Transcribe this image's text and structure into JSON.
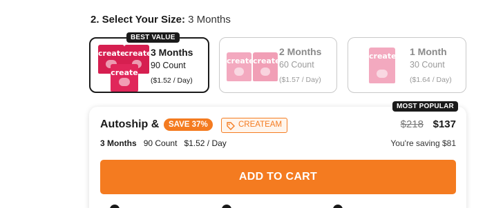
{
  "size_section": {
    "label": "2. Select Your Size:",
    "selected": "3 Months"
  },
  "options": [
    {
      "badge": "BEST VALUE",
      "name": "3 Months",
      "count": "90 Count",
      "per_day": "($1.52 / Day)",
      "pouch_brand": "create",
      "selected": true
    },
    {
      "name": "2 Months",
      "count": "60 Count",
      "per_day": "($1.57 / Day)",
      "pouch_brand": "create",
      "selected": false
    },
    {
      "name": "1 Month",
      "count": "30 Count",
      "per_day": "($1.64 / Day)",
      "pouch_brand": "create",
      "selected": false
    }
  ],
  "autoship": {
    "badge": "MOST POPULAR",
    "title": "Autoship &",
    "save_label": "SAVE 37%",
    "promo_code": "CREATEAM",
    "old_price": "$218",
    "new_price": "$137",
    "plan": "3 Months",
    "count": "90 Count",
    "per_day": "$1.52 / Day",
    "saving_text": "You're saving $81",
    "button_label": "ADD TO CART"
  },
  "colors": {
    "accent": "#f47b20",
    "pouch_red": "#e0265a",
    "pouch_pink": "#f29bb4"
  },
  "icons": [
    "tag-icon",
    "check-circle-icon"
  ]
}
